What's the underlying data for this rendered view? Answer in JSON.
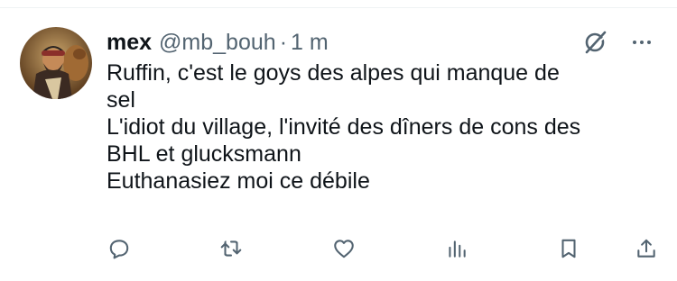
{
  "tweet": {
    "author_name": "mex",
    "author_handle": "@mb_bouh",
    "separator": "·",
    "timestamp": "1 m",
    "body_lines": [
      "Ruffin, c'est le goys des alpes qui manque de",
      "sel",
      "L'idiot du village, l'invité des dîners de cons des",
      "BHL et glucksmann",
      "Euthanasiez moi ce débile"
    ]
  },
  "icons": {
    "header": [
      "grok-icon",
      "more-options-icon"
    ],
    "actions": [
      "reply-icon",
      "retweet-icon",
      "like-icon",
      "views-icon",
      "bookmark-icon",
      "share-icon"
    ]
  },
  "colors": {
    "text": "#0f1419",
    "secondary": "#536471",
    "divider": "#eff3f4"
  }
}
